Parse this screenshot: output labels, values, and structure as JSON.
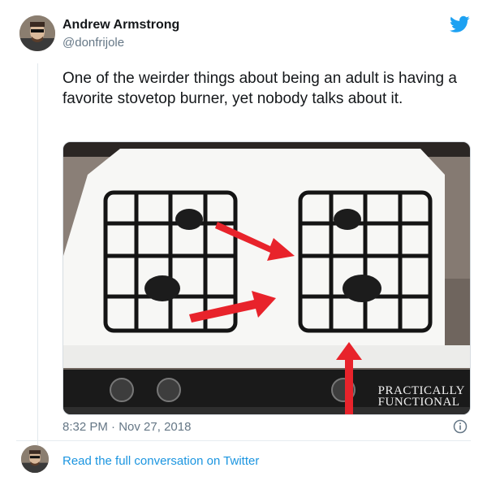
{
  "author": {
    "name": "Andrew Armstrong",
    "handle": "@donfrijole"
  },
  "tweet": {
    "text": "One of the weirder things about being an adult is having a favorite stovetop burner, yet nobody talks about it.",
    "time": "8:32 PM",
    "separator": "·",
    "date": "Nov 27, 2018"
  },
  "media": {
    "watermark_line1": "PRACTICALLY",
    "watermark_line2": "FUNCTIONAL"
  },
  "footer": {
    "read_more": "Read the full conversation on Twitter"
  },
  "colors": {
    "twitter_blue": "#1da1f2",
    "link_blue": "#1b95e0",
    "arrow_red": "#e8232b",
    "secondary_text": "#657786"
  },
  "icons": [
    "twitter-bird-icon",
    "info-icon",
    "red-arrow-icon"
  ]
}
